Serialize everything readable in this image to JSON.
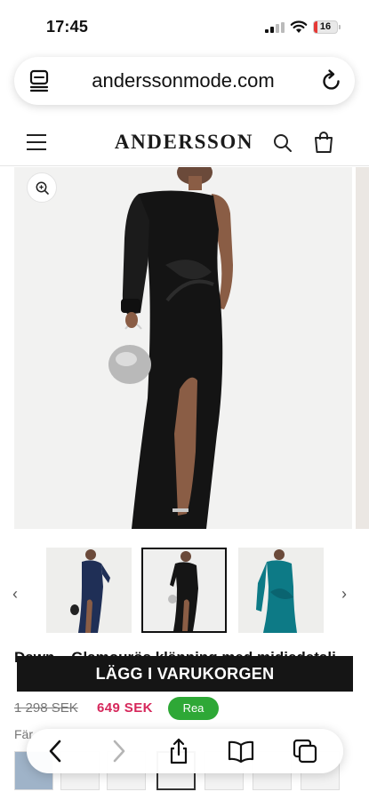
{
  "status_bar": {
    "time": "17:45",
    "battery": "16",
    "battery_level": 0.16
  },
  "browser": {
    "url": "anderssonmode.com",
    "icons": [
      "tabs-overview-icon",
      "reload-icon"
    ]
  },
  "site_header": {
    "logo": "ANDERSSON",
    "icons": [
      "hamburger-menu-icon",
      "search-icon",
      "shopping-bag-icon"
    ]
  },
  "gallery": {
    "main_image": "black-one-shoulder-dress-photo",
    "zoom_icon": "zoom-in-icon",
    "thumbnails": [
      {
        "name": "navy-dress-thumbnail",
        "color": "#1f2f56",
        "selected": false
      },
      {
        "name": "black-dress-thumbnail",
        "color": "#121212",
        "selected": true
      },
      {
        "name": "teal-dress-thumbnail",
        "color": "#0d7a86",
        "selected": false
      }
    ],
    "prev_icon": "‹",
    "next_icon": "›"
  },
  "product": {
    "title": "Dawn – Glamourös klänning med midjedetalj",
    "cart_button": "LÄGG I VARUKORGEN",
    "old_price": "1 298 SEK",
    "new_price": "649 SEK",
    "sale_badge": "Rea",
    "color_label": "Fär",
    "colors": {
      "sale_price": "#d6275b",
      "badge": "#2ea836",
      "button": "#151515"
    }
  },
  "toolbar": {
    "icons": [
      "back-icon",
      "forward-icon",
      "share-icon",
      "bookmarks-icon",
      "tabs-icon"
    ]
  }
}
